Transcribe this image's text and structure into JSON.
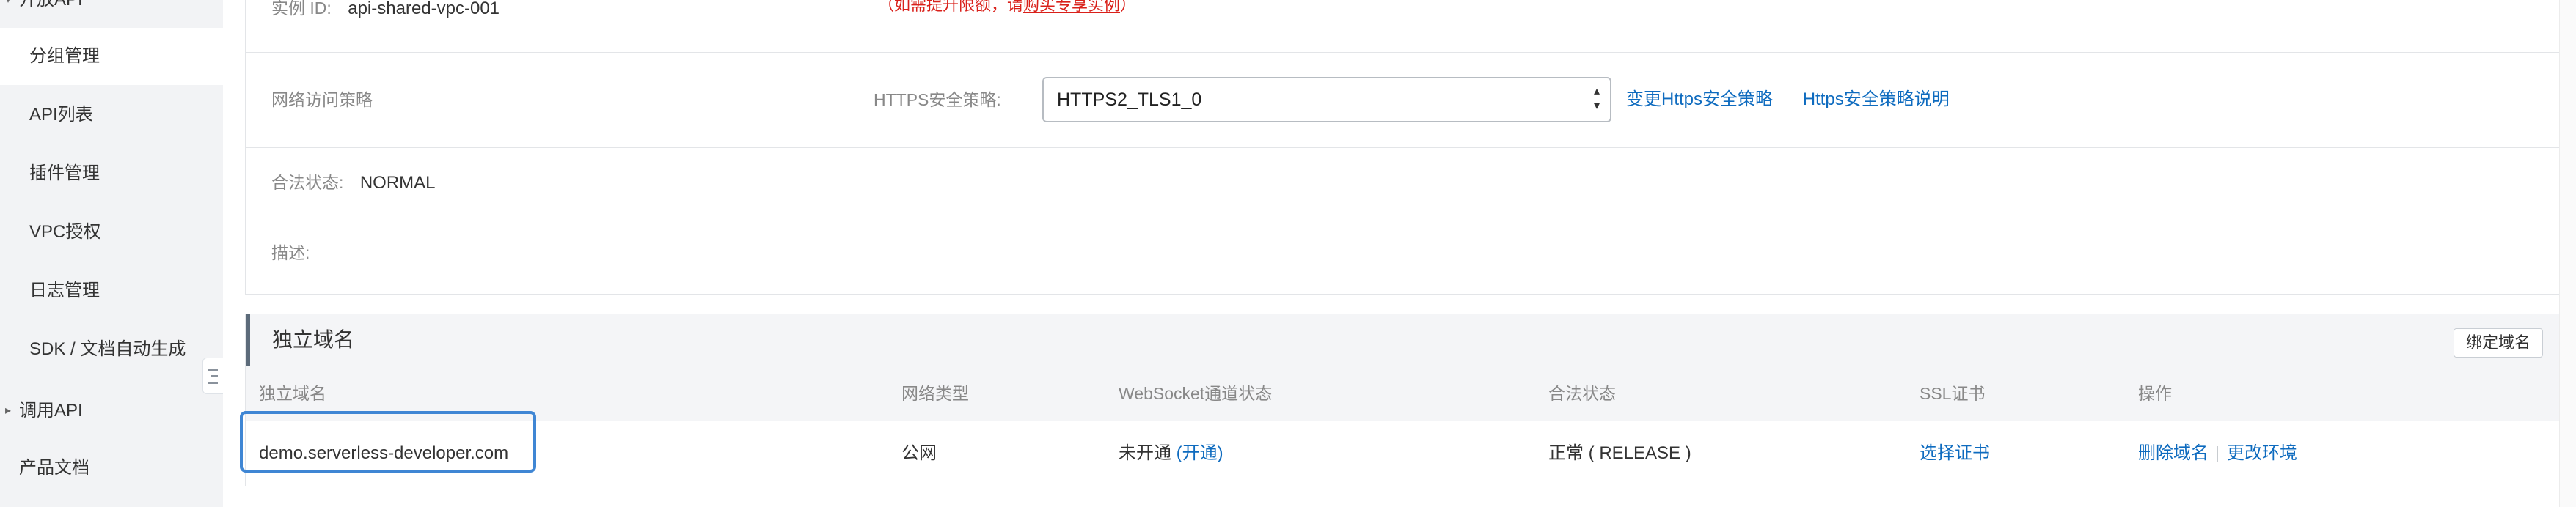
{
  "sidebar": {
    "items": [
      {
        "label": "开放API"
      },
      {
        "label": "分组管理"
      },
      {
        "label": "API列表"
      },
      {
        "label": "插件管理"
      },
      {
        "label": "VPC授权"
      },
      {
        "label": "日志管理"
      },
      {
        "label": "SDK / 文档自动生成"
      },
      {
        "label": "调用API"
      },
      {
        "label": "产品文档"
      }
    ]
  },
  "instance": {
    "label": "实例 ID:",
    "value": "api-shared-vpc-001",
    "note_prefix": "（如需提升限额，请",
    "note_link": "购买专享实例",
    "note_suffix": "）"
  },
  "network_policy": {
    "label": "网络访问策略",
    "https_label": "HTTPS安全策略:",
    "https_value": "HTTPS2_TLS1_0",
    "change_link": "变更Https安全策略",
    "doc_link": "Https安全策略说明"
  },
  "legal": {
    "label": "合法状态:",
    "value": "NORMAL"
  },
  "description": {
    "label": "描述:"
  },
  "domain_section": {
    "title": "独立域名",
    "bind_button": "绑定域名",
    "headers": [
      "独立域名",
      "网络类型",
      "WebSocket通道状态",
      "合法状态",
      "SSL证书",
      "操作"
    ],
    "row": {
      "domain": "demo.serverless-developer.com",
      "network_type": "公网",
      "websocket_status": "未开通",
      "websocket_action": "(开通)",
      "legal_status": "正常 ( RELEASE )",
      "ssl_action": "选择证书",
      "delete_action": "删除域名",
      "change_env_action": "更改环境"
    }
  }
}
